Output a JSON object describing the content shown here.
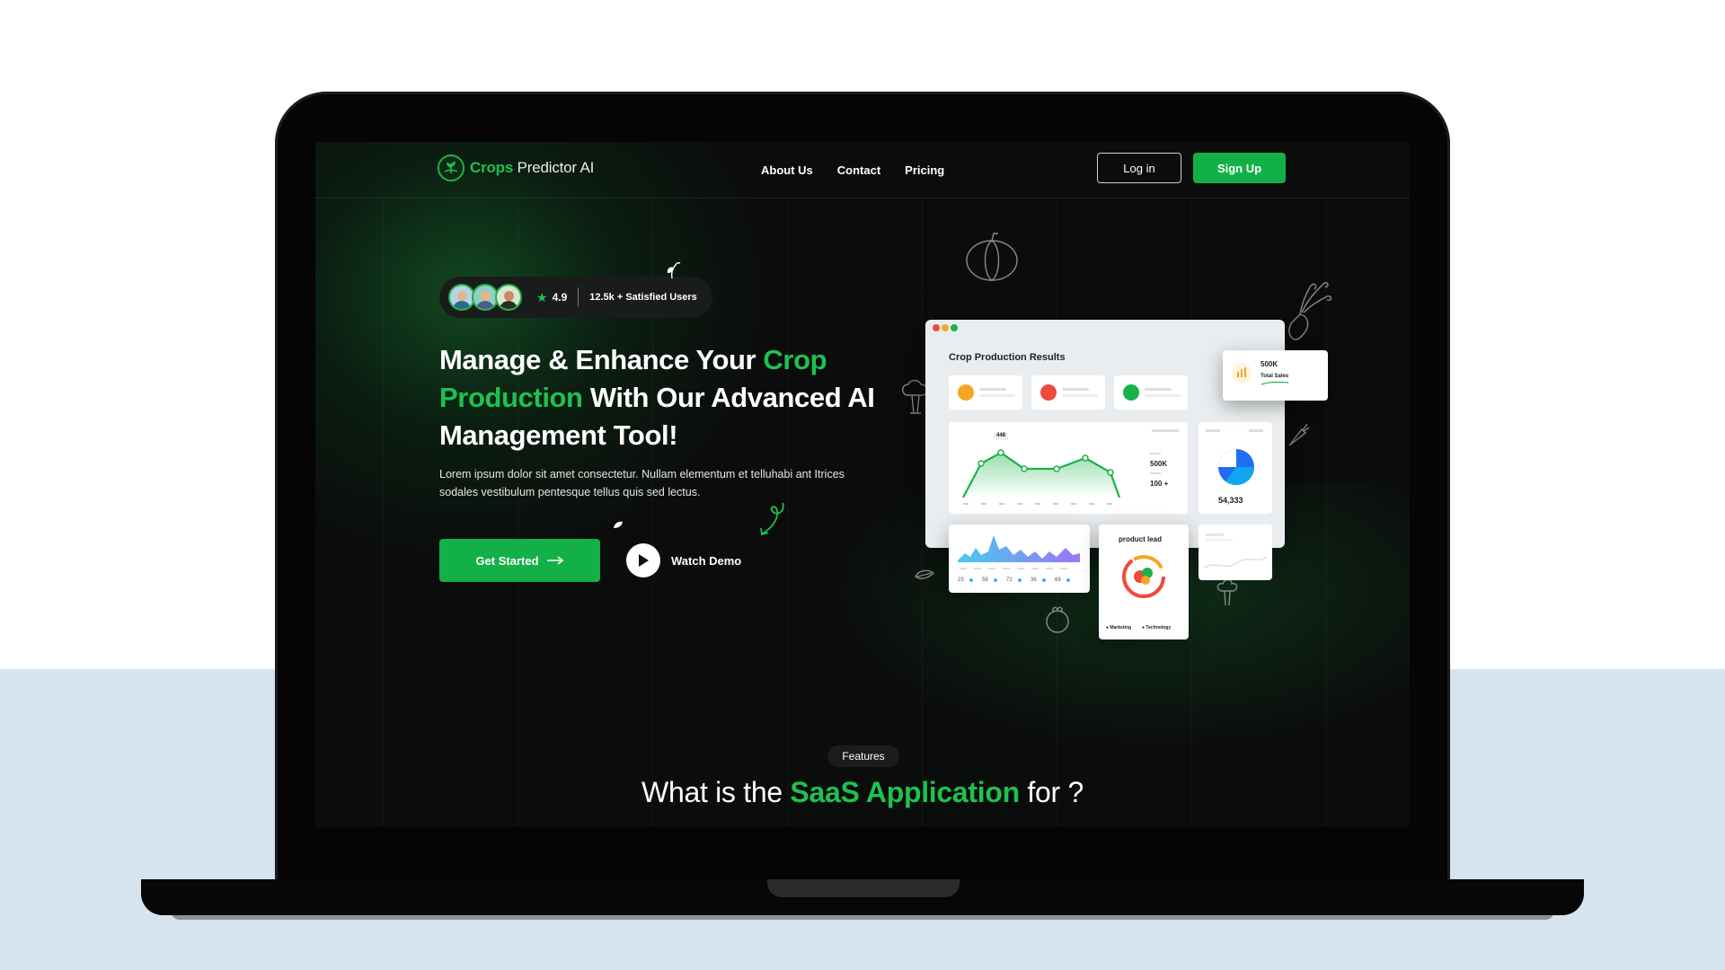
{
  "brand": {
    "prefix": "Crops",
    "suffix": " Predictor AI"
  },
  "nav": {
    "links": [
      "About Us",
      "Contact",
      "Pricing"
    ],
    "login": "Log in",
    "signup": "Sign Up"
  },
  "hero": {
    "rating": "4.9",
    "users": "12.5k + Satisfied Users",
    "title_1": "Manage & Enhance Your ",
    "title_green": "Crop Production",
    "title_2": " With Our Advanced AI Management Tool!",
    "description": "Lorem ipsum dolor sit amet consectetur. Nullam elementum et telluhabi ant Itrices sodales vestibulum pentesque tellus quis sed lectus.",
    "cta": "Get Started",
    "demo": "Watch Demo"
  },
  "dashboard": {
    "title": "Crop Production Results",
    "peak_label": "448",
    "stat_a": "500K",
    "stat_b": "100 +",
    "pie_value": "54,333",
    "sales_value": "500K",
    "sales_label": "Total Sales",
    "lead_title": "product lead",
    "lead_legend_1": "Marketing",
    "lead_legend_2": "Technology",
    "area_values": [
      "23",
      "58",
      "72",
      "36",
      "69"
    ],
    "colors": {
      "orange": "#f5a623",
      "red": "#f0483e",
      "green": "#17b34a",
      "accent": "#13b047"
    }
  },
  "features": {
    "pill": "Features",
    "title_1": "What is the ",
    "title_green": "SaaS Application",
    "title_2": " for ?"
  }
}
